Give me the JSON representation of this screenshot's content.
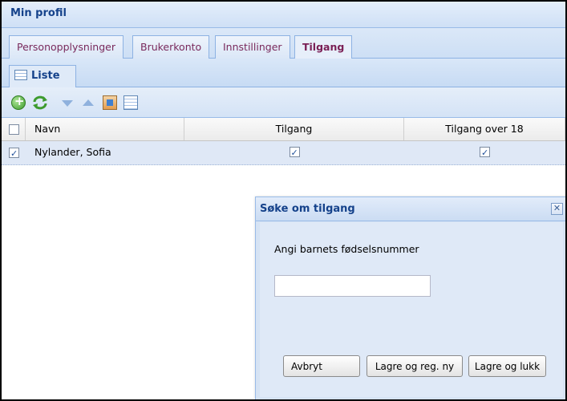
{
  "window": {
    "title": "Min profil"
  },
  "tabs": [
    {
      "label": "Personopplysninger",
      "active": false
    },
    {
      "label": "Brukerkonto",
      "active": false
    },
    {
      "label": "Innstillinger",
      "active": false
    },
    {
      "label": "Tilgang",
      "active": true
    }
  ],
  "subtab": {
    "label": "Liste",
    "icon": "grid-icon"
  },
  "toolbar": {
    "buttons": [
      "add-icon",
      "refresh-icon",
      "move-down-icon",
      "move-up-icon",
      "export-icon",
      "columns-icon"
    ]
  },
  "grid": {
    "columns": [
      "Navn",
      "Tilgang",
      "Tilgang over 18"
    ],
    "rows": [
      {
        "selected": true,
        "name": "Nylander, Sofia",
        "tilgang": true,
        "tilgang_over_18": true
      }
    ]
  },
  "dialog": {
    "title": "Søke om tilgang",
    "label": "Angi barnets fødselsnummer",
    "input_value": "",
    "buttons": {
      "cancel": "Avbryt",
      "save_new": "Lagre og reg. ny",
      "save_close": "Lagre og lukk"
    }
  },
  "colors": {
    "accent": "#15428b",
    "tab_text": "#7a2a5c",
    "header_bg": "#cfe0f6",
    "row_selected": "#dfe8f6"
  }
}
